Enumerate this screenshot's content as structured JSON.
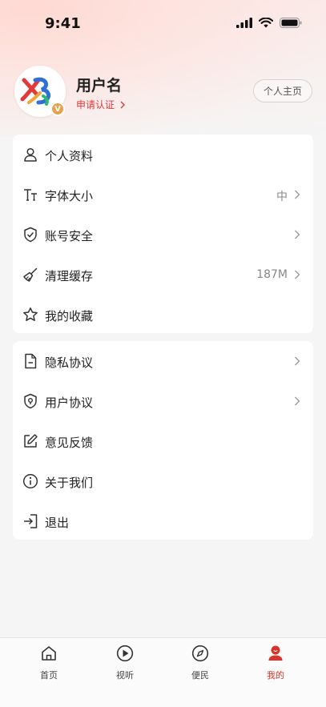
{
  "status_bar": {
    "time": "9:41"
  },
  "profile": {
    "username": "用户名",
    "verify_label": "申请认证",
    "badge_letter": "V",
    "home_button_label": "个人主页"
  },
  "settings_group_1": [
    {
      "label": "个人资料",
      "icon": "user-icon",
      "value": "",
      "chevron": false
    },
    {
      "label": "字体大小",
      "icon": "font-size-icon",
      "value": "中",
      "chevron": true
    },
    {
      "label": "账号安全",
      "icon": "shield-check-icon",
      "value": "",
      "chevron": true
    },
    {
      "label": "清理缓存",
      "icon": "broom-icon",
      "value": "187M",
      "chevron": true
    },
    {
      "label": "我的收藏",
      "icon": "star-icon",
      "value": "",
      "chevron": false
    }
  ],
  "settings_group_2": [
    {
      "label": "隐私协议",
      "icon": "document-icon",
      "value": "",
      "chevron": true
    },
    {
      "label": "用户协议",
      "icon": "shield-pin-icon",
      "value": "",
      "chevron": true
    },
    {
      "label": "意见反馈",
      "icon": "edit-icon",
      "value": "",
      "chevron": false
    },
    {
      "label": "关于我们",
      "icon": "info-icon",
      "value": "",
      "chevron": false
    },
    {
      "label": "退出",
      "icon": "logout-icon",
      "value": "",
      "chevron": false
    }
  ],
  "tabbar": [
    {
      "label": "首页",
      "icon": "home-icon",
      "active": false
    },
    {
      "label": "视听",
      "icon": "play-icon",
      "active": false
    },
    {
      "label": "便民",
      "icon": "compass-icon",
      "active": false
    },
    {
      "label": "我的",
      "icon": "profile-icon",
      "active": true
    }
  ],
  "colors": {
    "accent": "#d9342b",
    "verify": "#e23a3a",
    "badge": "#e8a24a"
  }
}
